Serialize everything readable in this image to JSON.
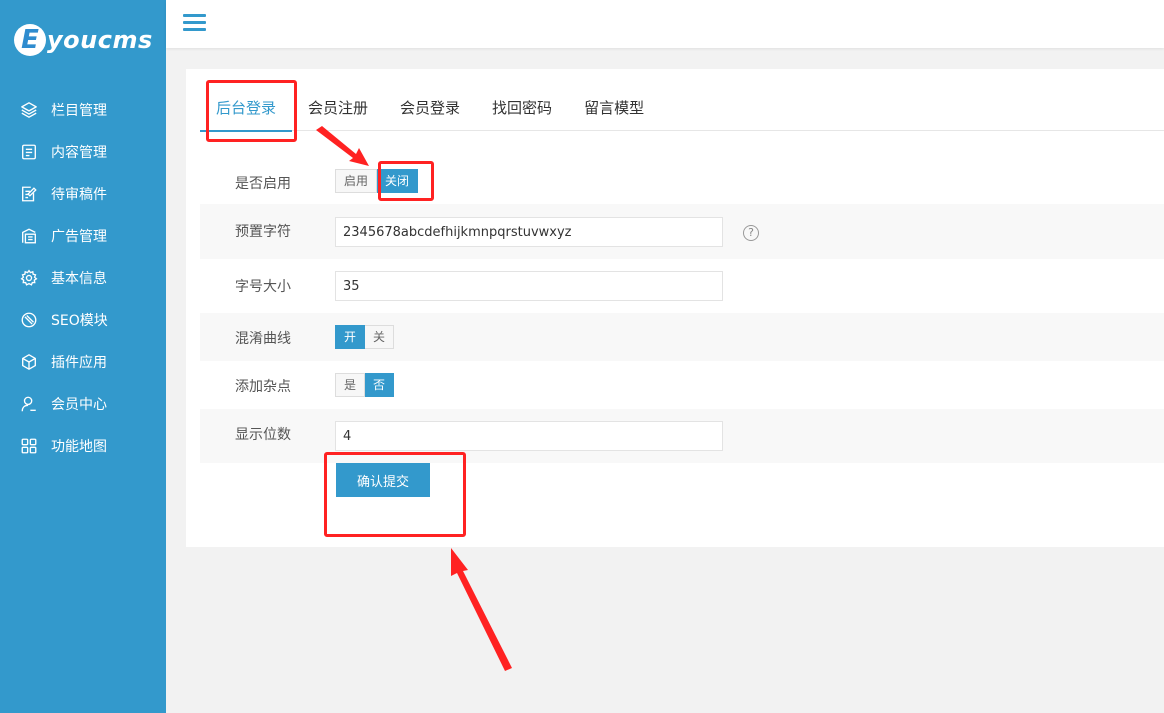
{
  "brand": {
    "logo_letter": "E",
    "logo_text": "youcms"
  },
  "sidebar": {
    "items": [
      {
        "label": "栏目管理",
        "icon": "layers-icon"
      },
      {
        "label": "内容管理",
        "icon": "document-icon"
      },
      {
        "label": "待审稿件",
        "icon": "edit-document-icon"
      },
      {
        "label": "广告管理",
        "icon": "ad-icon"
      },
      {
        "label": "基本信息",
        "icon": "gear-icon"
      },
      {
        "label": "SEO模块",
        "icon": "seo-icon"
      },
      {
        "label": "插件应用",
        "icon": "cube-icon"
      },
      {
        "label": "会员中心",
        "icon": "user-icon"
      },
      {
        "label": "功能地图",
        "icon": "grid-icon"
      }
    ]
  },
  "tabs": [
    {
      "label": "后台登录",
      "active": true
    },
    {
      "label": "会员注册",
      "active": false
    },
    {
      "label": "会员登录",
      "active": false
    },
    {
      "label": "找回密码",
      "active": false
    },
    {
      "label": "留言模型",
      "active": false
    }
  ],
  "form": {
    "enable": {
      "label": "是否启用",
      "options": [
        "启用",
        "关闭"
      ],
      "selected": "关闭"
    },
    "charset": {
      "label": "预置字符",
      "value": "2345678abcdefhijkmnpqrstuvwxyz",
      "help_icon": "question-circle-icon"
    },
    "font_size": {
      "label": "字号大小",
      "value": "35"
    },
    "curve": {
      "label": "混淆曲线",
      "options": [
        "开",
        "关"
      ],
      "selected": "开"
    },
    "noise": {
      "label": "添加杂点",
      "options": [
        "是",
        "否"
      ],
      "selected": "否"
    },
    "digits": {
      "label": "显示位数",
      "value": "4"
    },
    "submit_label": "确认提交"
  },
  "colors": {
    "accent": "#3399cc",
    "annotation": "#ff2222",
    "page_bg": "#f2f2f2"
  }
}
